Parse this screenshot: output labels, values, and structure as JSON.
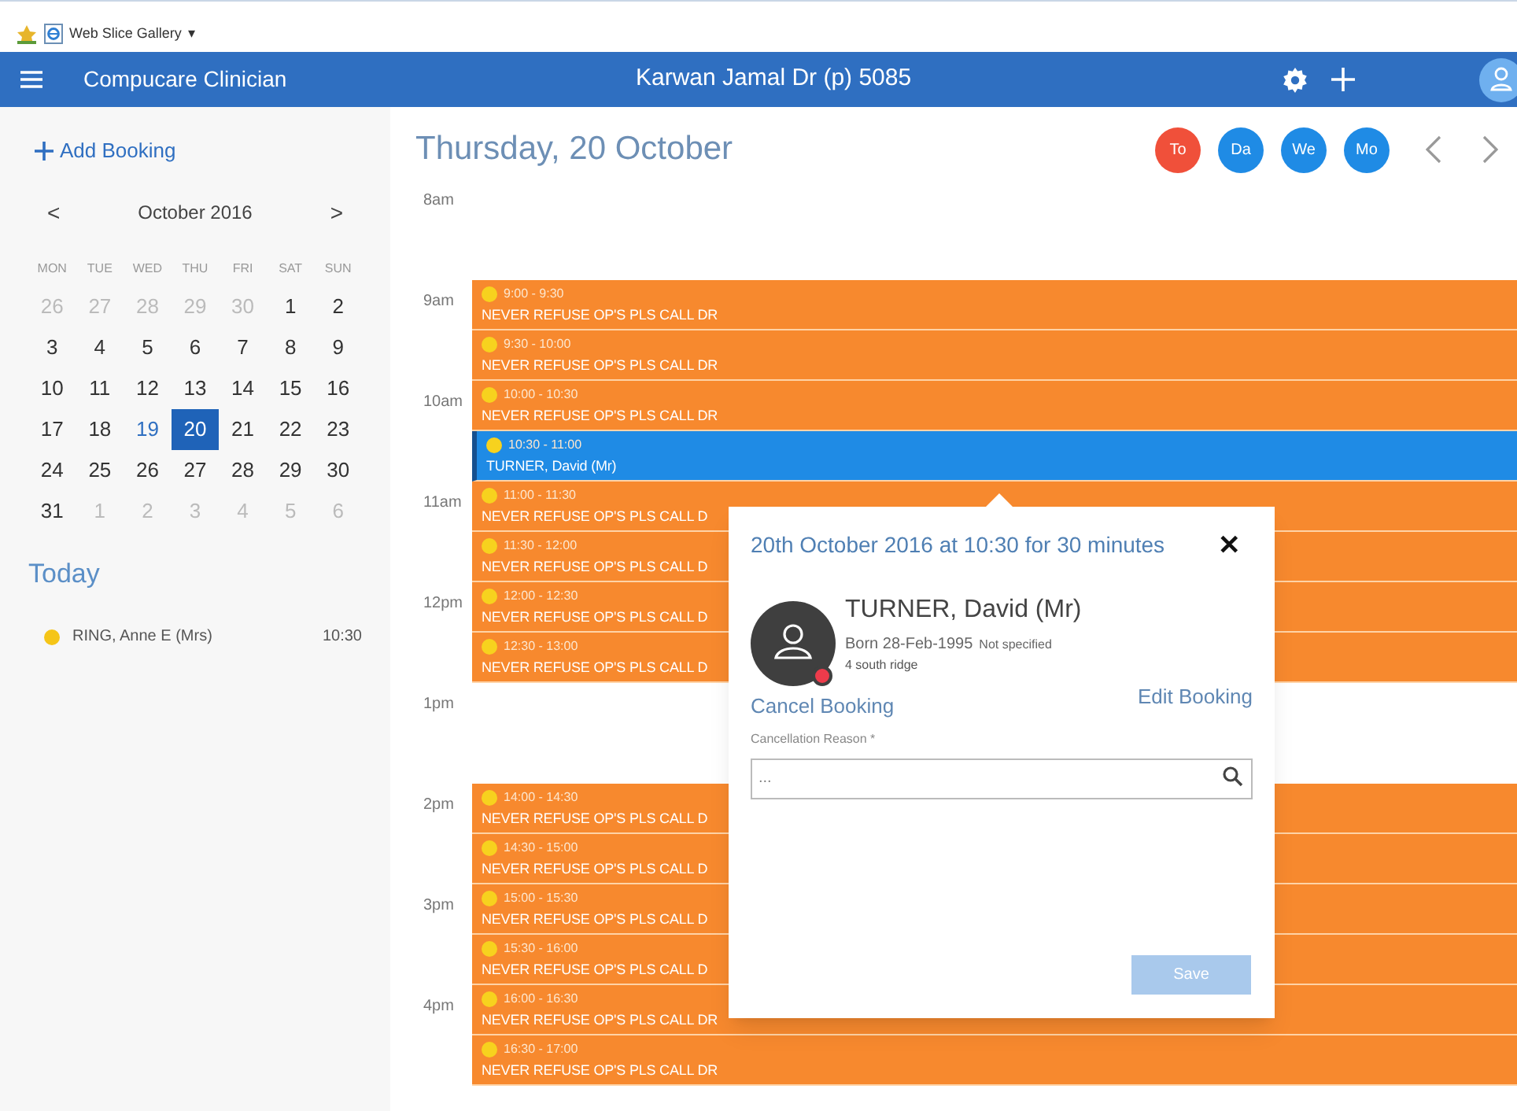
{
  "favorites_bar": {
    "item": "Web Slice Gallery",
    "caret": "▾"
  },
  "header": {
    "app_title": "Compucare Clinician",
    "clinician": "Karwan Jamal Dr (p) 5085"
  },
  "sidebar": {
    "add_booking": "Add Booking",
    "calendar": {
      "month": "October 2016",
      "prev": "<",
      "next": ">",
      "weekdays": [
        "MON",
        "TUE",
        "WED",
        "THU",
        "FRI",
        "SAT",
        "SUN"
      ],
      "days": [
        {
          "day": "26",
          "kind": "outside",
          "selected": false
        },
        {
          "day": "27",
          "kind": "outside",
          "selected": false
        },
        {
          "day": "28",
          "kind": "outside",
          "selected": false
        },
        {
          "day": "29",
          "kind": "outside",
          "selected": false
        },
        {
          "day": "30",
          "kind": "outside",
          "selected": false
        },
        {
          "day": "1",
          "kind": "inside",
          "selected": false
        },
        {
          "day": "2",
          "kind": "inside",
          "selected": false
        },
        {
          "day": "3",
          "kind": "inside",
          "selected": false
        },
        {
          "day": "4",
          "kind": "inside",
          "selected": false
        },
        {
          "day": "5",
          "kind": "inside",
          "selected": false
        },
        {
          "day": "6",
          "kind": "inside",
          "selected": false
        },
        {
          "day": "7",
          "kind": "inside",
          "selected": false
        },
        {
          "day": "8",
          "kind": "inside",
          "selected": false
        },
        {
          "day": "9",
          "kind": "inside",
          "selected": false
        },
        {
          "day": "10",
          "kind": "inside",
          "selected": false
        },
        {
          "day": "11",
          "kind": "inside",
          "selected": false
        },
        {
          "day": "12",
          "kind": "inside",
          "selected": false
        },
        {
          "day": "13",
          "kind": "inside",
          "selected": false
        },
        {
          "day": "14",
          "kind": "inside",
          "selected": false
        },
        {
          "day": "15",
          "kind": "inside",
          "selected": false
        },
        {
          "day": "16",
          "kind": "inside",
          "selected": false
        },
        {
          "day": "17",
          "kind": "inside",
          "selected": false
        },
        {
          "day": "18",
          "kind": "inside",
          "selected": false
        },
        {
          "day": "19",
          "kind": "accent",
          "selected": false
        },
        {
          "day": "20",
          "kind": "inside",
          "selected": true
        },
        {
          "day": "21",
          "kind": "inside",
          "selected": false
        },
        {
          "day": "22",
          "kind": "inside",
          "selected": false
        },
        {
          "day": "23",
          "kind": "inside",
          "selected": false
        },
        {
          "day": "24",
          "kind": "inside",
          "selected": false
        },
        {
          "day": "25",
          "kind": "inside",
          "selected": false
        },
        {
          "day": "26",
          "kind": "inside",
          "selected": false
        },
        {
          "day": "27",
          "kind": "inside",
          "selected": false
        },
        {
          "day": "28",
          "kind": "inside",
          "selected": false
        },
        {
          "day": "29",
          "kind": "inside",
          "selected": false
        },
        {
          "day": "30",
          "kind": "inside",
          "selected": false
        },
        {
          "day": "31",
          "kind": "inside",
          "selected": false
        },
        {
          "day": "1",
          "kind": "outside",
          "selected": false
        },
        {
          "day": "2",
          "kind": "outside",
          "selected": false
        },
        {
          "day": "3",
          "kind": "outside",
          "selected": false
        },
        {
          "day": "4",
          "kind": "outside",
          "selected": false
        },
        {
          "day": "5",
          "kind": "outside",
          "selected": false
        },
        {
          "day": "6",
          "kind": "outside",
          "selected": false
        }
      ]
    },
    "today_heading": "Today",
    "today_items": [
      {
        "name": "RING, Anne E (Mrs)",
        "time": "10:30",
        "color": "#f5c518"
      }
    ]
  },
  "day_view": {
    "title": "Thursday, 20 October",
    "views": [
      {
        "label": "To",
        "selected": true
      },
      {
        "label": "Da",
        "selected": false
      },
      {
        "label": "We",
        "selected": false
      },
      {
        "label": "Mo",
        "selected": false
      }
    ],
    "slots": [
      {
        "kind": "empty",
        "hour_label": "8am"
      },
      {
        "kind": "empty"
      },
      {
        "hour_label": "9am",
        "booking": {
          "time": "9:00 - 9:30",
          "text": "NEVER REFUSE OP'S PLS CALL DR",
          "selected": false
        }
      },
      {
        "booking": {
          "time": "9:30 - 10:00",
          "text": "NEVER REFUSE OP'S PLS CALL DR",
          "selected": false
        }
      },
      {
        "hour_label": "10am",
        "booking": {
          "time": "10:00 - 10:30",
          "text": "NEVER REFUSE OP'S PLS CALL DR",
          "selected": false
        }
      },
      {
        "booking": {
          "time": "10:30 - 11:00",
          "text": "TURNER, David (Mr)",
          "selected": true
        }
      },
      {
        "hour_label": "11am",
        "booking": {
          "time": "11:00 - 11:30",
          "text": "NEVER REFUSE OP'S PLS CALL D",
          "selected": false
        }
      },
      {
        "booking": {
          "time": "11:30 - 12:00",
          "text": "NEVER REFUSE OP'S PLS CALL D",
          "selected": false
        }
      },
      {
        "hour_label": "12pm",
        "booking": {
          "time": "12:00 - 12:30",
          "text": "NEVER REFUSE OP'S PLS CALL D",
          "selected": false
        }
      },
      {
        "booking": {
          "time": "12:30 - 13:00",
          "text": "NEVER REFUSE OP'S PLS CALL D",
          "selected": false
        }
      },
      {
        "kind": "empty",
        "hour_label": "1pm"
      },
      {
        "kind": "empty"
      },
      {
        "hour_label": "2pm",
        "booking": {
          "time": "14:00 - 14:30",
          "text": "NEVER REFUSE OP'S PLS CALL D",
          "selected": false
        }
      },
      {
        "booking": {
          "time": "14:30 - 15:00",
          "text": "NEVER REFUSE OP'S PLS CALL D",
          "selected": false
        }
      },
      {
        "hour_label": "3pm",
        "booking": {
          "time": "15:00 - 15:30",
          "text": "NEVER REFUSE OP'S PLS CALL D",
          "selected": false
        }
      },
      {
        "booking": {
          "time": "15:30 - 16:00",
          "text": "NEVER REFUSE OP'S PLS CALL D",
          "selected": false
        }
      },
      {
        "hour_label": "4pm",
        "booking": {
          "time": "16:00 - 16:30",
          "text": "NEVER REFUSE OP'S PLS CALL DR",
          "selected": false
        }
      },
      {
        "booking": {
          "time": "16:30 - 17:00",
          "text": "NEVER REFUSE OP'S PLS CALL DR",
          "selected": false
        }
      }
    ]
  },
  "booking_popup": {
    "title": "20th October 2016 at 10:30 for 30 minutes",
    "close": "✕",
    "patient": {
      "name": "TURNER, David (Mr)",
      "born": "Born 28-Feb-1995",
      "gender": "Not specified",
      "address": "4 south ridge",
      "alert": true
    },
    "cancel_link": "Cancel Booking",
    "edit_link": "Edit Booking",
    "reason_label": "Cancellation Reason *",
    "reason_placeholder": "...",
    "save": "Save"
  }
}
